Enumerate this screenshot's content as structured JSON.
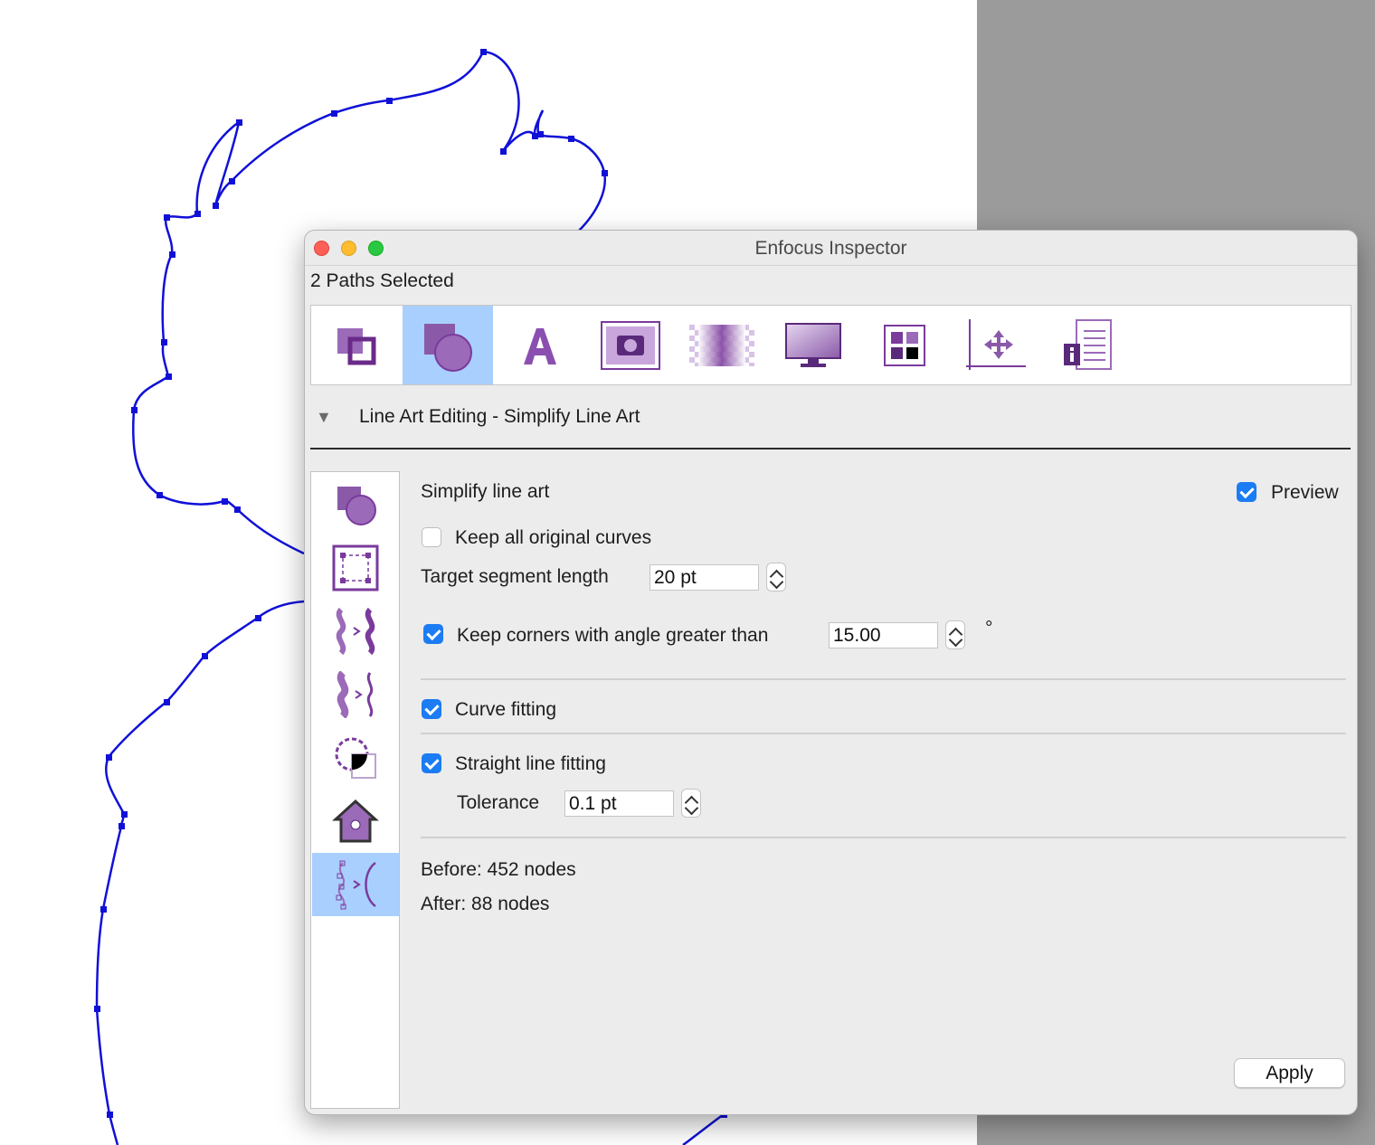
{
  "window": {
    "title": "Enfocus Inspector",
    "selection_status": "2 Paths Selected"
  },
  "toolbar": {
    "items": [
      {
        "icon": "object-arrange-icon"
      },
      {
        "icon": "line-art-shapes-icon",
        "active": true
      },
      {
        "icon": "text-icon"
      },
      {
        "icon": "camera-image-icon"
      },
      {
        "icon": "transparency-icon"
      },
      {
        "icon": "monitor-icon"
      },
      {
        "icon": "color-swatches-icon"
      },
      {
        "icon": "position-axes-icon"
      },
      {
        "icon": "info-document-icon"
      }
    ]
  },
  "section": {
    "title": "Line Art Editing - Simplify Line Art"
  },
  "sidebar": {
    "items": [
      {
        "icon": "shape-overlap-icon"
      },
      {
        "icon": "bounding-box-icon"
      },
      {
        "icon": "wave-transform-icon"
      },
      {
        "icon": "wave-transform-2-icon"
      },
      {
        "icon": "dashed-circle-corner-icon"
      },
      {
        "icon": "house-icon"
      },
      {
        "icon": "simplify-curve-icon",
        "active": true
      }
    ]
  },
  "panel": {
    "heading": "Simplify line art",
    "preview_label": "Preview",
    "preview_checked": true,
    "keep_curves_label": "Keep all original curves",
    "keep_curves_checked": false,
    "target_length_label": "Target segment length",
    "target_length_value": "20 pt",
    "keep_corners_label": "Keep corners with angle greater than",
    "keep_corners_checked": true,
    "angle_value": "15.00",
    "angle_unit": "°",
    "curve_fitting_label": "Curve fitting",
    "curve_fitting_checked": true,
    "straight_fitting_label": "Straight line fitting",
    "straight_fitting_checked": true,
    "tolerance_label": "Tolerance",
    "tolerance_value": "0.1 pt",
    "before_text": "Before: 452 nodes",
    "after_text": "After: 88 nodes",
    "apply_label": "Apply"
  },
  "colors": {
    "path_stroke": "#1010d8",
    "accent": "#1b7cf4",
    "selected_bg": "#a9cfff",
    "icon_purple": "#7a3b9c",
    "pasteboard": "#9b9b9b"
  }
}
